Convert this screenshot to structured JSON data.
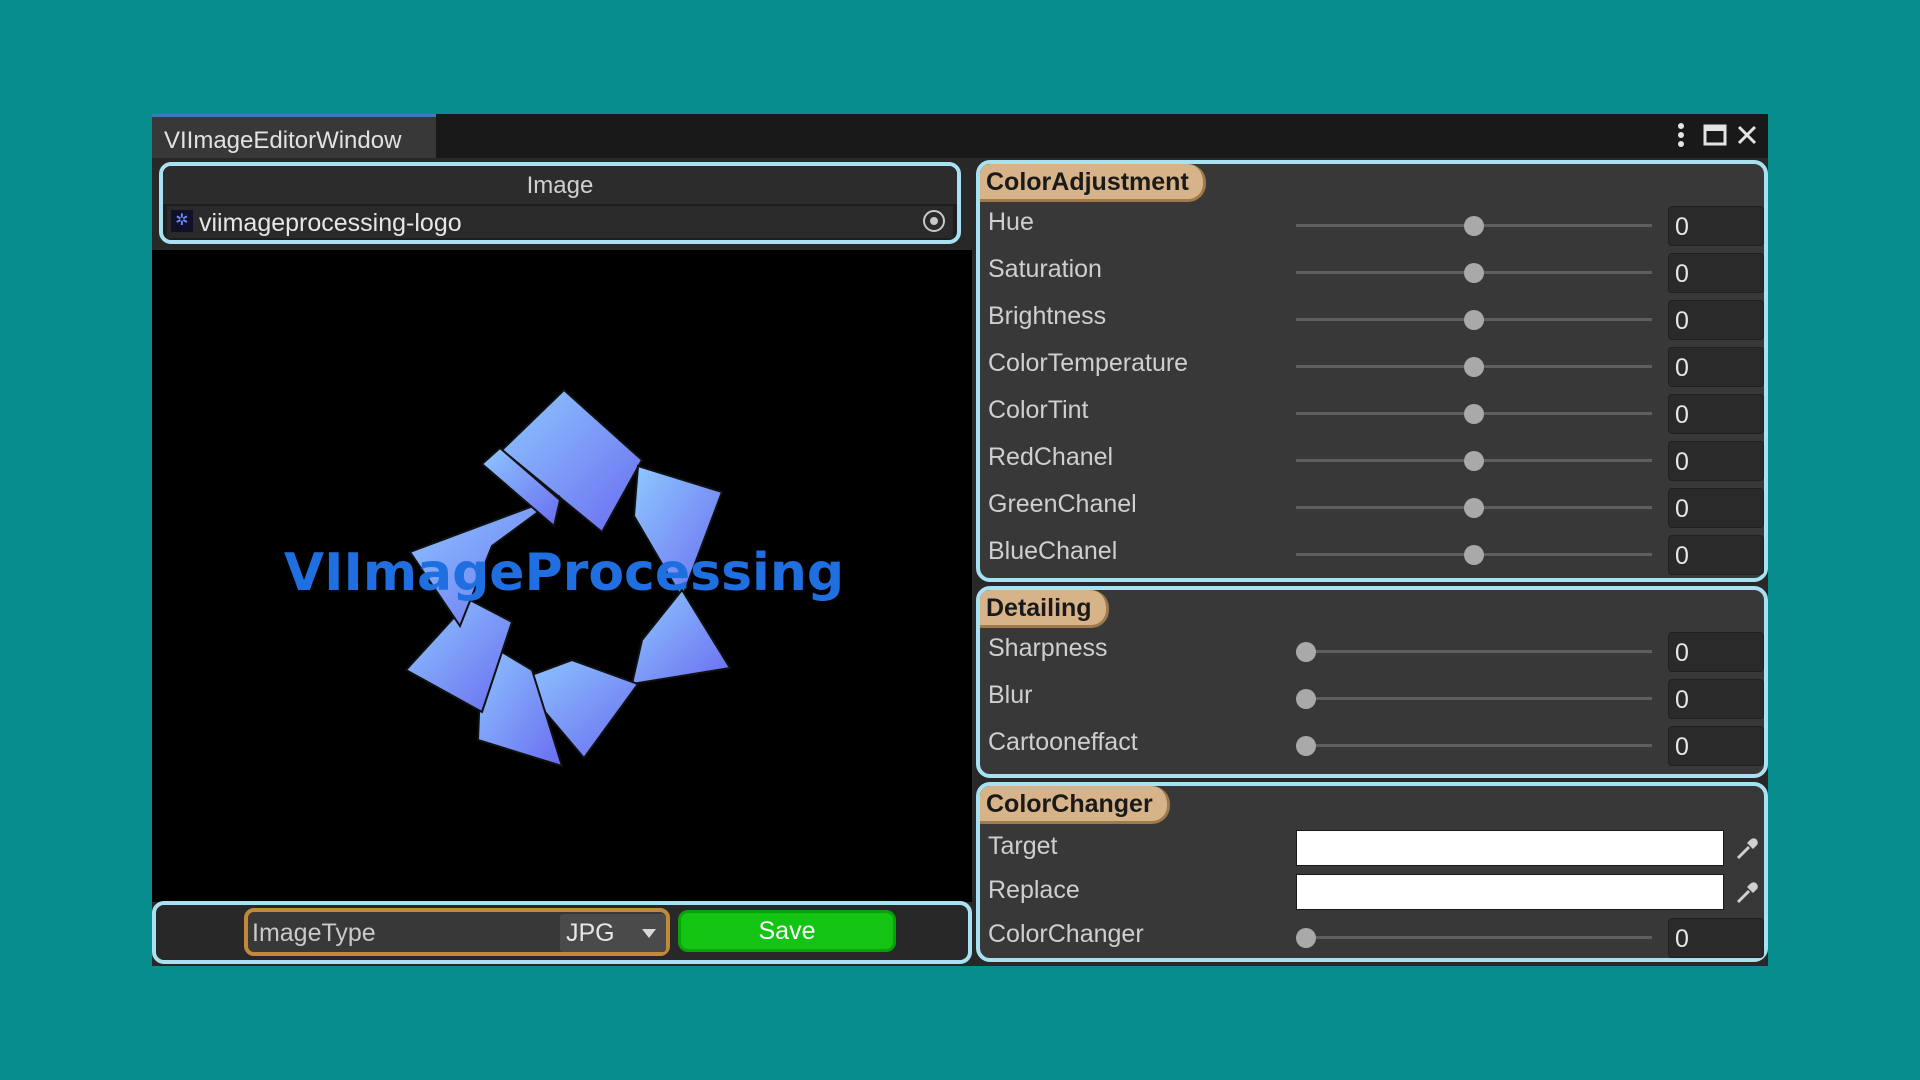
{
  "window": {
    "title": "VIImageEditorWindow"
  },
  "image_panel": {
    "header": "Image",
    "object_name": "viimageprocessing-logo"
  },
  "preview": {
    "logo_text": "VIImageProcessing"
  },
  "bottom_bar": {
    "image_type_label": "ImageType",
    "image_type_value": "JPG",
    "save_label": "Save"
  },
  "color_adjustment": {
    "title": "ColorAdjustment",
    "rows": [
      {
        "label": "Hue",
        "value": "0",
        "level": 0.5
      },
      {
        "label": "Saturation",
        "value": "0",
        "level": 0.5
      },
      {
        "label": "Brightness",
        "value": "0",
        "level": 0.5
      },
      {
        "label": "ColorTemperature",
        "value": "0",
        "level": 0.5
      },
      {
        "label": "ColorTint",
        "value": "0",
        "level": 0.5
      },
      {
        "label": "RedChanel",
        "value": "0",
        "level": 0.5
      },
      {
        "label": "GreenChanel",
        "value": "0",
        "level": 0.5
      },
      {
        "label": "BlueChanel",
        "value": "0",
        "level": 0.5
      }
    ]
  },
  "detailing": {
    "title": "Detailing",
    "rows": [
      {
        "label": "Sharpness",
        "value": "0",
        "level": 0
      },
      {
        "label": "Blur",
        "value": "0",
        "level": 0
      },
      {
        "label": "Cartooneffact",
        "value": "0",
        "level": 0
      }
    ]
  },
  "color_changer": {
    "title": "ColorChanger",
    "target_label": "Target",
    "target_color": "#ffffff",
    "replace_label": "Replace",
    "replace_color": "#ffffff",
    "slider_label": "ColorChanger",
    "slider_value": "0",
    "slider_level": 0
  },
  "colors": {
    "background": "#078d8d",
    "outline": "#a8e2f2",
    "save_button": "#13c413",
    "section_title": "#d7b38a",
    "logo_text": "#1f6fe0"
  }
}
